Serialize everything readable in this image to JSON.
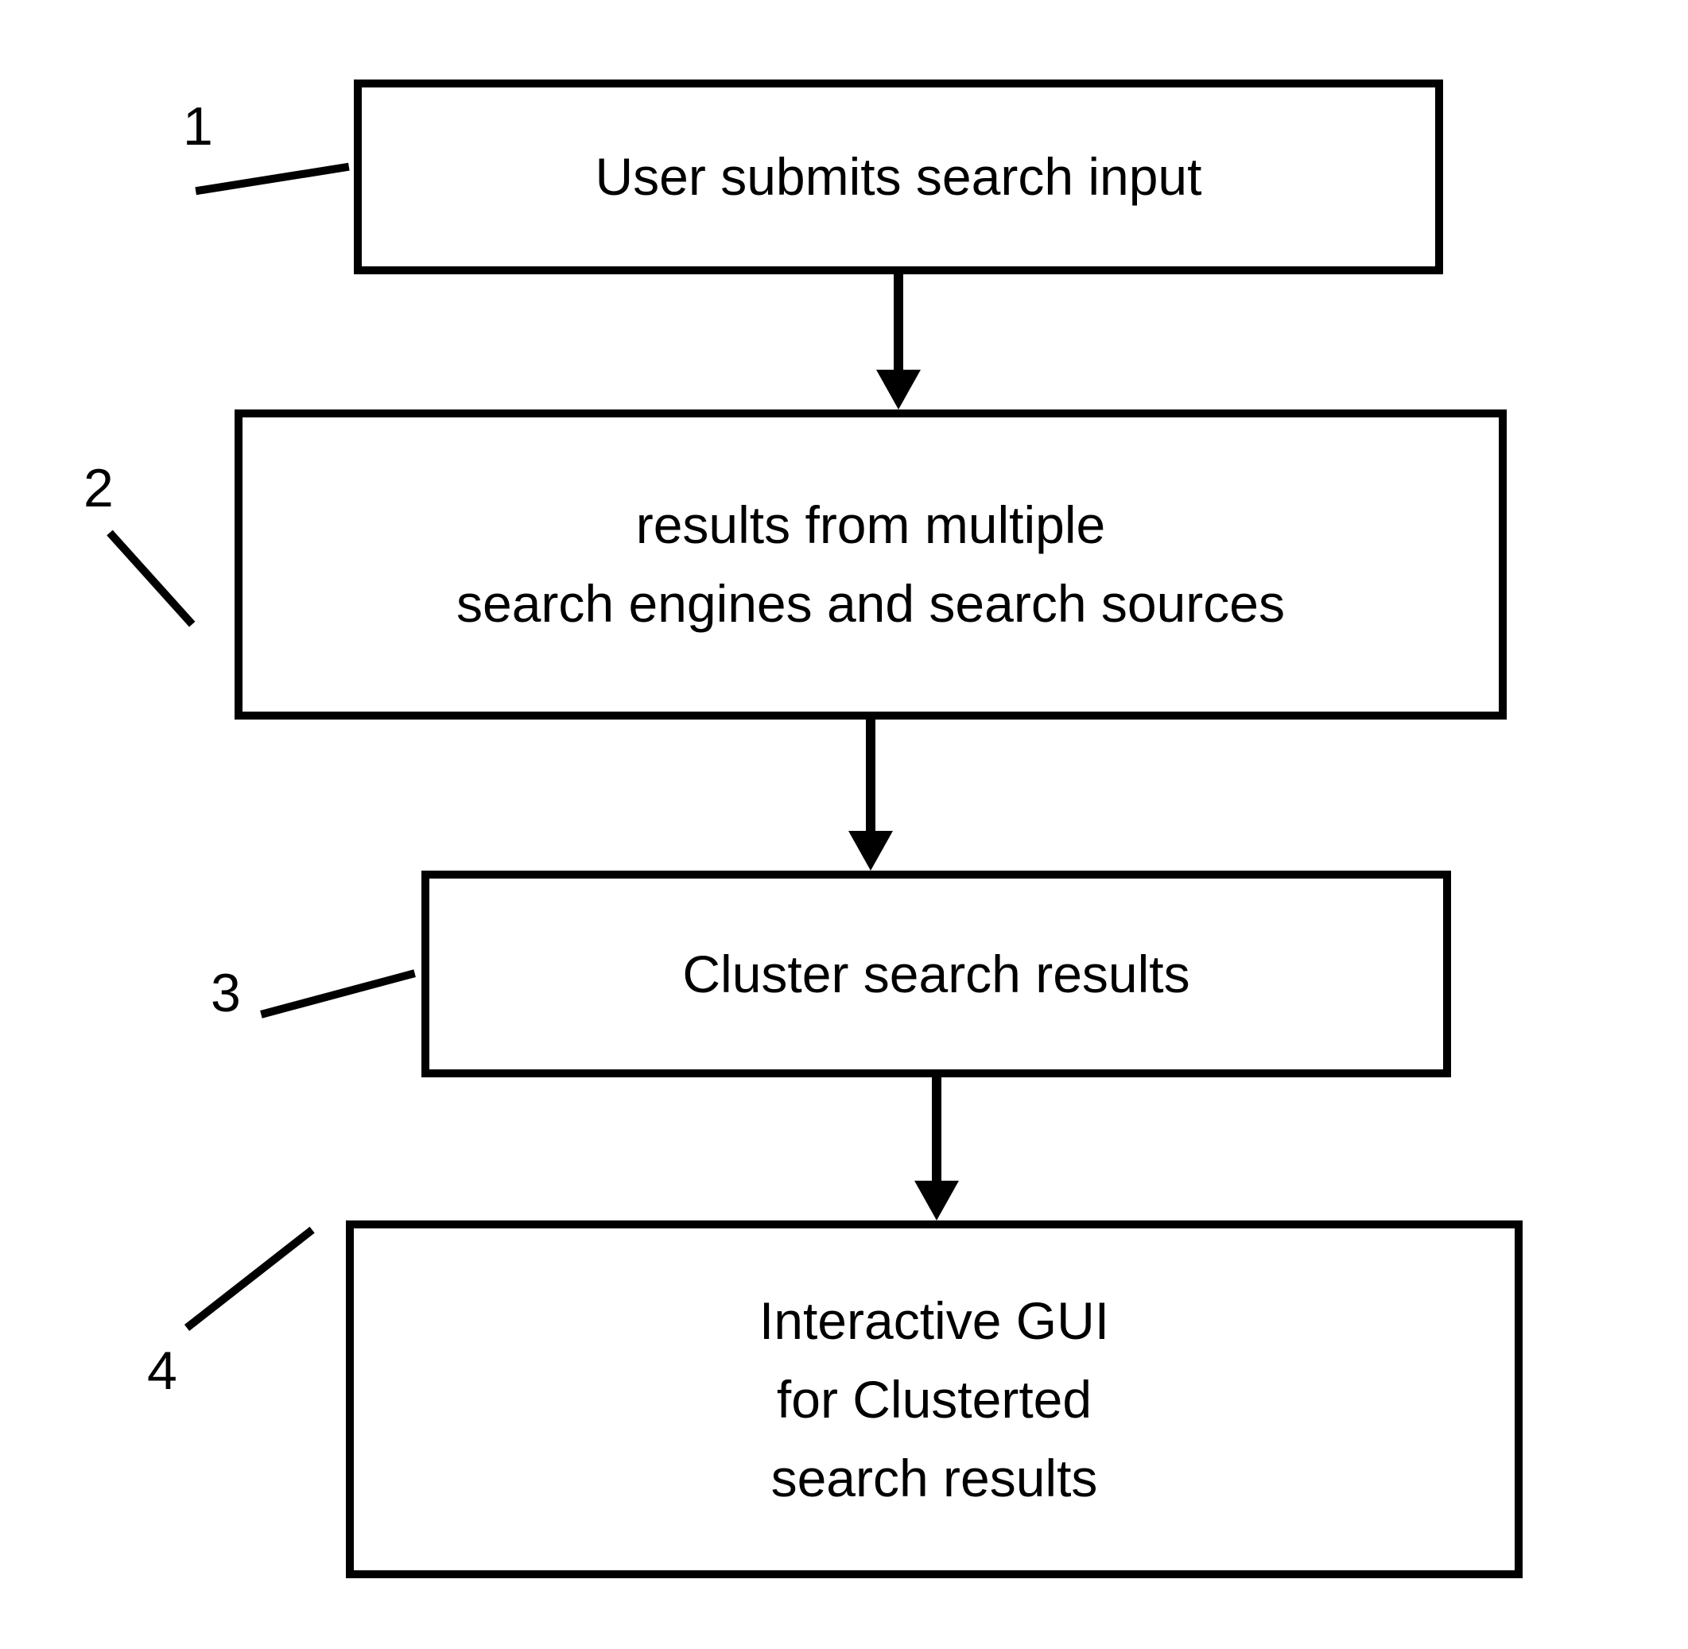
{
  "steps": [
    {
      "number": "1",
      "lines": [
        "User submits search input"
      ]
    },
    {
      "number": "2",
      "lines": [
        "results from multiple",
        "search engines and search sources"
      ]
    },
    {
      "number": "3",
      "lines": [
        "Cluster search results"
      ]
    },
    {
      "number": "4",
      "lines": [
        "Interactive GUI",
        "for Clusterted",
        "search results"
      ]
    }
  ]
}
